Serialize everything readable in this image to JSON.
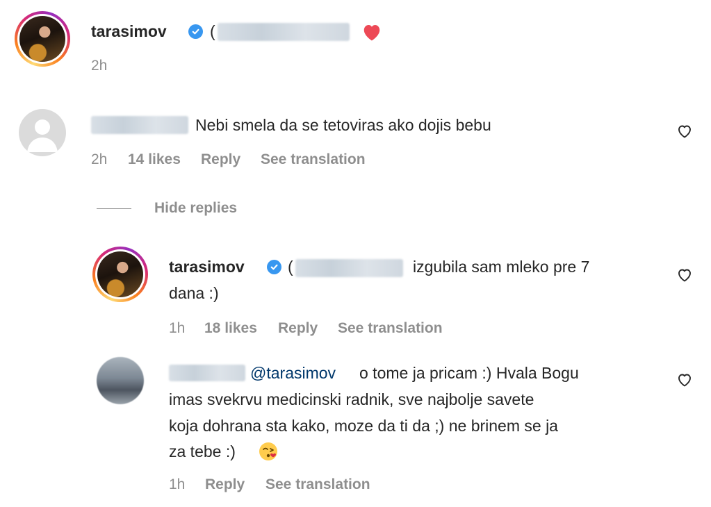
{
  "post": {
    "username": "tarasimov",
    "open_paren": "(",
    "time": "2h"
  },
  "comment1": {
    "text": "Nebi smela da se tetoviras ako dojis bebu",
    "time": "2h",
    "likes": "14 likes",
    "reply": "Reply",
    "translate": "See translation"
  },
  "replies_toggle": "Hide replies",
  "reply1": {
    "username": "tarasimov",
    "open_paren": "(",
    "text_line1": "izgubila sam mleko pre 7",
    "text_line2": "dana :)",
    "time": "1h",
    "likes": "18 likes",
    "reply": "Reply",
    "translate": "See translation"
  },
  "reply2": {
    "mention": "@tarasimov",
    "text_line1": "o tome ja pricam :) Hvala Bogu",
    "text_line2": "imas svekrvu medicinski radnik, sve najbolje savete",
    "text_line3": "koja dohrana sta kako, moze da ti da ;) ne brinem se ja",
    "text_line4": "za tebe :)",
    "emoji": "😘",
    "time": "1h",
    "reply": "Reply",
    "translate": "See translation"
  },
  "colors": {
    "verified": "#3897f0",
    "heart": "#ed4956",
    "mention": "#00376b",
    "meta": "#8e8e8e"
  },
  "icons": [
    "verified-badge-icon",
    "red-heart-icon",
    "like-heart-icon",
    "default-avatar-icon"
  ]
}
